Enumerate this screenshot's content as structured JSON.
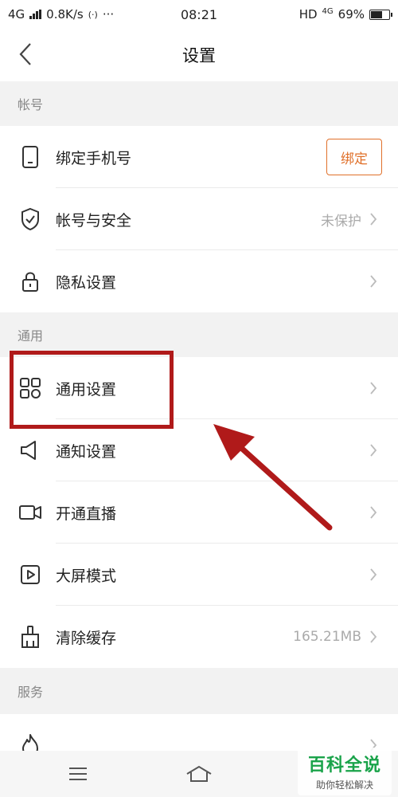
{
  "status_bar": {
    "network": "4G",
    "speed": "0.8K/s",
    "hotspot_icon": "(·)",
    "more_icon": "···",
    "time": "08:21",
    "hd": "HD",
    "net_type": "4G",
    "battery_text": "69%",
    "battery_level": 0.69
  },
  "nav": {
    "back_icon": "chevron-left-icon",
    "title": "设置"
  },
  "sections": {
    "account": {
      "header": "帐号",
      "rows": [
        {
          "label": "绑定手机号",
          "icon": "phone-icon",
          "button": "绑定"
        },
        {
          "label": "帐号与安全",
          "icon": "shield-icon",
          "value": "未保护"
        },
        {
          "label": "隐私设置",
          "icon": "lock-icon"
        }
      ]
    },
    "general": {
      "header": "通用",
      "rows": [
        {
          "label": "通用设置",
          "icon": "grid-icon"
        },
        {
          "label": "通知设置",
          "icon": "speaker-icon"
        },
        {
          "label": "开通直播",
          "icon": "camera-icon"
        },
        {
          "label": "大屏模式",
          "icon": "play-icon"
        },
        {
          "label": "清除缓存",
          "icon": "broom-icon",
          "value": "165.21MB"
        }
      ]
    },
    "services": {
      "header": "服务",
      "rows": [
        {
          "label": "",
          "icon": "flame-icon"
        }
      ]
    }
  },
  "annotation": {
    "color": "#b01a1a"
  },
  "bottom_bar": {
    "menu_icon": "menu-icon",
    "home_icon": "home-icon"
  },
  "watermark": {
    "title": "百科全说",
    "subtitle": "助你轻松解决"
  },
  "colors": {
    "accent": "#e0702a",
    "background": "#f2f2f2"
  }
}
